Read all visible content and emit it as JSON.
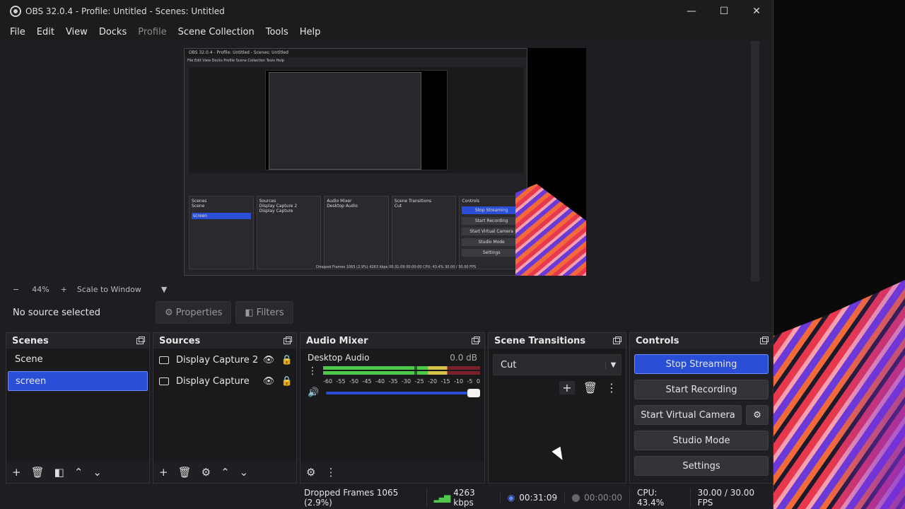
{
  "window": {
    "title": "OBS 32.0.4 - Profile: Untitled - Scenes: Untitled",
    "controls": {
      "minimize": "—",
      "maximize": "☐",
      "close": "✕"
    }
  },
  "menu": {
    "items": [
      "File",
      "Edit",
      "View",
      "Docks",
      "Profile",
      "Scene Collection",
      "Tools",
      "Help"
    ]
  },
  "zoom": {
    "minus": "−",
    "level": "44%",
    "plus": "+",
    "mode": "Scale to Window"
  },
  "properties_bar": {
    "no_source": "No source selected",
    "properties": "Properties",
    "filters": "Filters"
  },
  "scenes": {
    "title": "Scenes",
    "items": [
      {
        "label": "Scene",
        "selected": false
      },
      {
        "label": "screen",
        "selected": true
      }
    ]
  },
  "sources": {
    "title": "Sources",
    "items": [
      {
        "label": "Display Capture 2"
      },
      {
        "label": "Display Capture"
      }
    ]
  },
  "audio_mixer": {
    "title": "Audio Mixer",
    "channel": "Desktop Audio",
    "db": "0.0 dB",
    "ticks": [
      "-60",
      "-55",
      "-50",
      "-45",
      "-40",
      "-35",
      "-30",
      "-25",
      "-20",
      "-15",
      "-10",
      "-5",
      "0"
    ],
    "volume": 1.0
  },
  "transitions": {
    "title": "Scene Transitions",
    "selected": "Cut"
  },
  "controls": {
    "title": "Controls",
    "stop_streaming": "Stop Streaming",
    "start_recording": "Start Recording",
    "start_virtual_camera": "Start Virtual Camera",
    "studio_mode": "Studio Mode",
    "settings": "Settings"
  },
  "status": {
    "dropped": "Dropped Frames 1065 (2.9%)",
    "bitrate": "4263 kbps",
    "stream_time": "00:31:09",
    "rec_time": "00:00:00",
    "cpu": "CPU: 43.4%",
    "fps": "30.00 / 30.00 FPS"
  },
  "colors": {
    "accent": "#2a4fd6",
    "meter_green": "#4ec94e",
    "meter_yellow": "#d4c24a",
    "meter_red": "#7a1f2c"
  }
}
